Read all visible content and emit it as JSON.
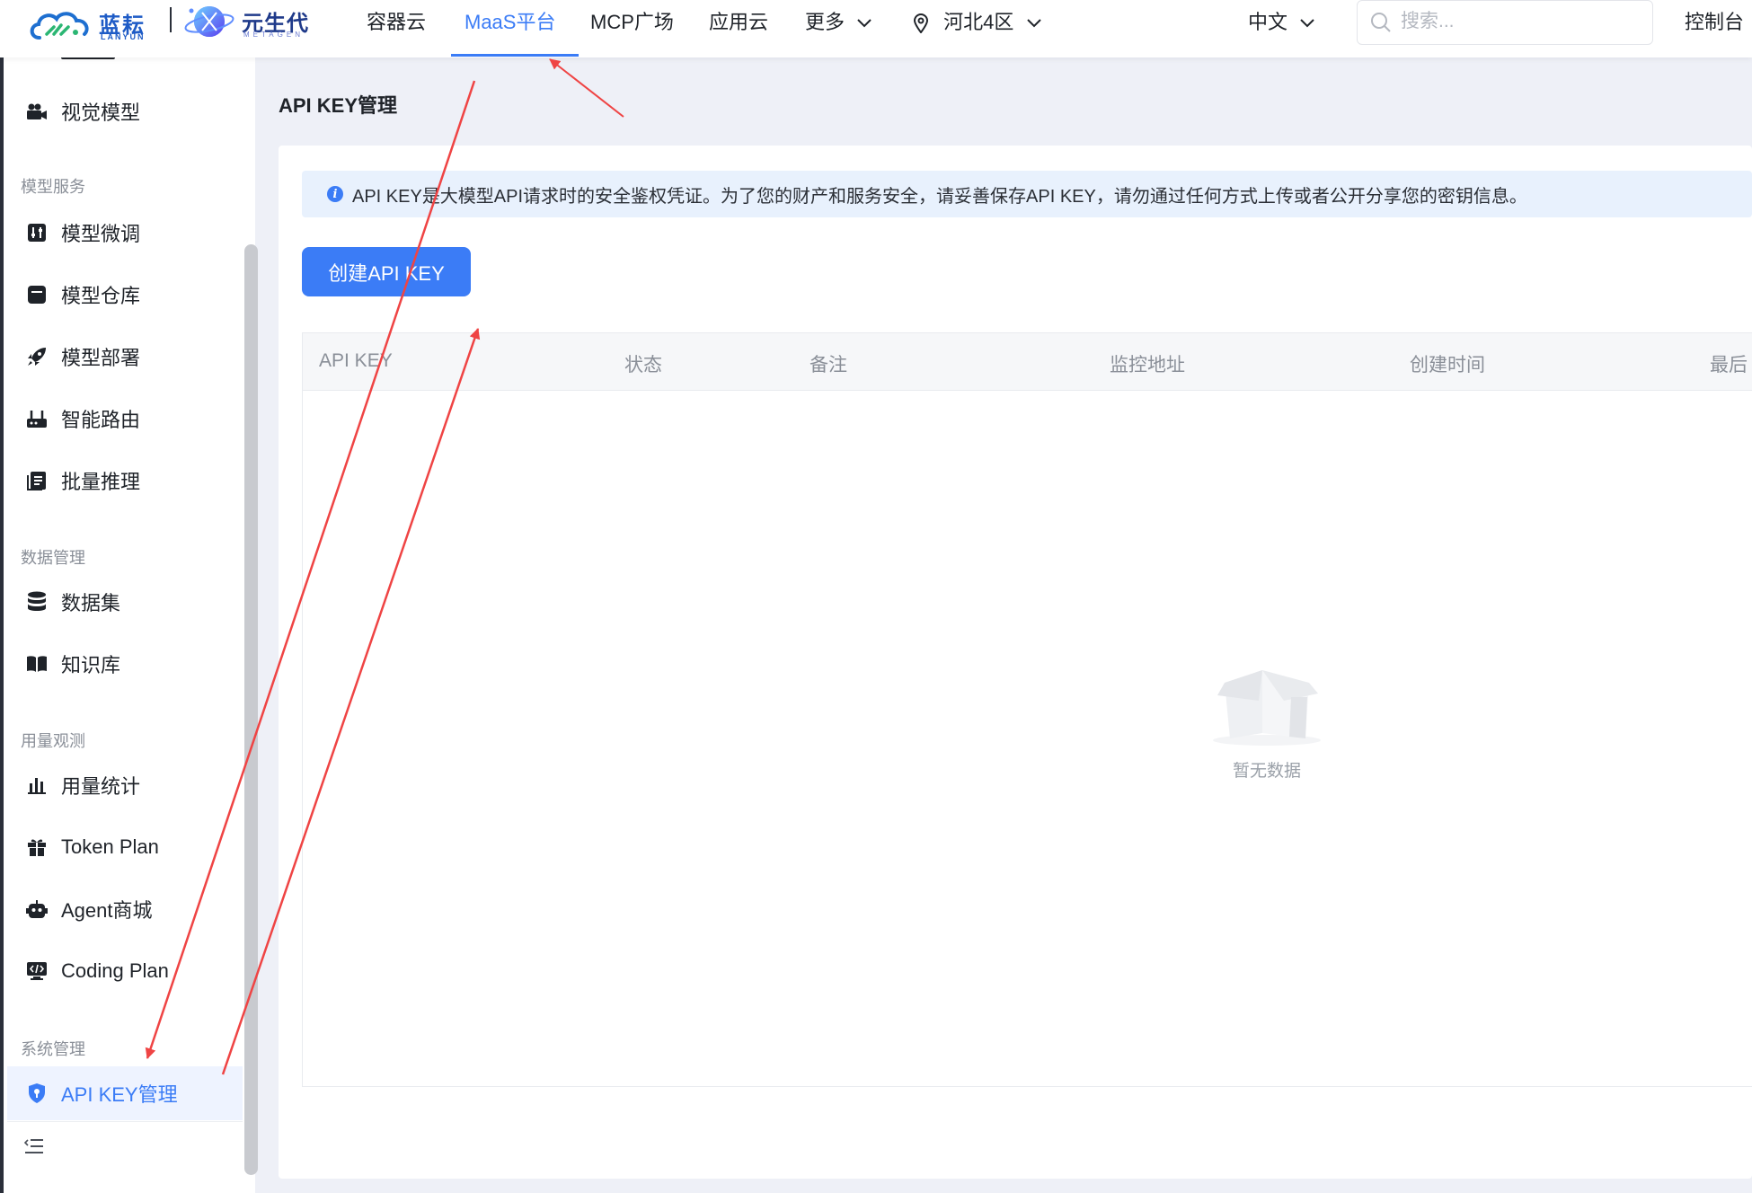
{
  "header": {
    "brand_lanyun_cn": "蓝耘",
    "brand_lanyun_en": "LANYUN",
    "brand_meta_cn": "元生代",
    "brand_meta_en": "METAGEN",
    "nav": {
      "container_cloud": "容器云",
      "maas": "MaaS平台",
      "mcp": "MCP广场",
      "app_cloud": "应用云",
      "more": "更多"
    },
    "region": "河北4区",
    "language": "中文",
    "search_placeholder": "搜索...",
    "console": "控制台"
  },
  "sidebar": {
    "items": {
      "vision": "视觉模型",
      "finetune": "模型微调",
      "repo": "模型仓库",
      "deploy": "模型部署",
      "routing": "智能路由",
      "batch": "批量推理",
      "dataset": "数据集",
      "kb": "知识库",
      "usage": "用量统计",
      "token_plan": "Token Plan",
      "agent": "Agent商城",
      "coding_plan": "Coding Plan",
      "apikey": "API KEY管理"
    },
    "groups": {
      "model_service": "模型服务",
      "data_mgmt": "数据管理",
      "usage_obs": "用量观测",
      "sys_mgmt": "系统管理"
    }
  },
  "main": {
    "title": "API KEY管理",
    "info": "API KEY是大模型API请求时的安全鉴权凭证。为了您的财产和服务安全，请妥善保存API KEY，请勿通过任何方式上传或者公开分享您的密钥信息。",
    "create_button": "创建API KEY",
    "table": {
      "col_key": "API KEY",
      "col_status": "状态",
      "col_remark": "备注",
      "col_monitor": "监控地址",
      "col_created": "创建时间",
      "col_last": "最后"
    },
    "empty_text": "暂无数据"
  },
  "colors": {
    "accent": "#3b7cf6",
    "annotation_arrow": "#ef4444"
  }
}
